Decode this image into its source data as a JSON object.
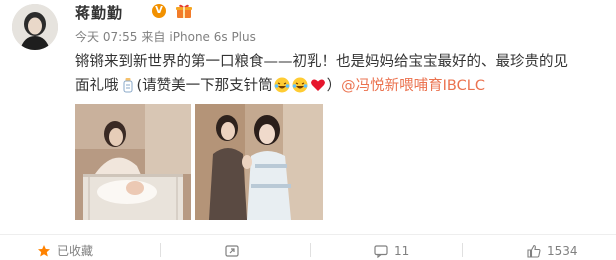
{
  "post": {
    "author": "蒋勤勤",
    "verified_mark": "V",
    "meta": {
      "time": "今天 07:55",
      "source_prefix": "来自",
      "source": "iPhone 6s Plus"
    },
    "content": {
      "line1": "锵锵来到新世界的第一口粮食——初乳！也是妈妈给宝宝最好的、最珍贵的见",
      "line2_prefix": "面礼哦",
      "line2_middle": "(请赞美一下那支针筒",
      "line2_suffix": "）",
      "mention": "@冯悦新喂哺育IBCLC"
    },
    "icons": {
      "badge": "gift-badge-icon",
      "bottle": "baby-bottle-icon",
      "laugh_emoji": "laughing-crying-emoji",
      "heart_emoji": "heart-emoji"
    },
    "photos": [
      {
        "alt": "baby-in-crib-photo"
      },
      {
        "alt": "mother-with-newborn-photo"
      }
    ]
  },
  "actions": {
    "collect_label": "已收藏",
    "forward_icon": "forward-icon",
    "comment_count": "11",
    "like_count": "1534"
  },
  "colors": {
    "text": "#333333",
    "meta": "#808080",
    "mention": "#eb7350",
    "verified": "#f29100",
    "heart": "#e6162d"
  }
}
